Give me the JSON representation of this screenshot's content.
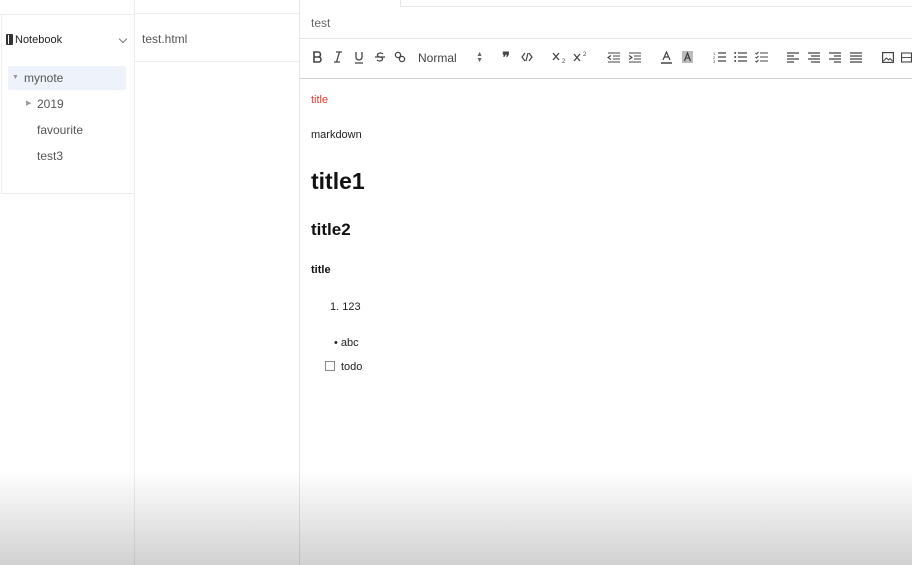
{
  "sidebar": {
    "notebook_label": "Notebook",
    "items": [
      {
        "label": "mynote",
        "expanded": true,
        "active": true
      },
      {
        "label": "2019",
        "expanded": false
      },
      {
        "label": "favourite"
      },
      {
        "label": "test3"
      }
    ]
  },
  "files": [
    {
      "label": "test.html"
    }
  ],
  "editor": {
    "title": "test",
    "toolbar": {
      "header_select": "Normal",
      "tools": [
        "bold-icon",
        "italic-icon",
        "underline-icon",
        "strike-icon",
        "link-icon",
        "quote-icon",
        "code-icon",
        "subscript-icon",
        "superscript-icon",
        "outdent-icon",
        "indent-icon",
        "font-color-icon",
        "background-color-icon",
        "ordered-list-icon",
        "bullet-list-icon",
        "check-list-icon",
        "align-left-icon",
        "align-center-icon",
        "align-right-icon",
        "align-justify-icon",
        "image-icon"
      ]
    },
    "content": {
      "title_red": "title",
      "paragraph": "markdown",
      "h1": "title1",
      "h2": "title2",
      "h3": "title",
      "ordered_item": "1. 123",
      "bullet_item": "• abc",
      "todo_item": "todo"
    },
    "colors": {
      "accent_red": "#e23a2e",
      "active_bg": "#eef3fb"
    }
  }
}
